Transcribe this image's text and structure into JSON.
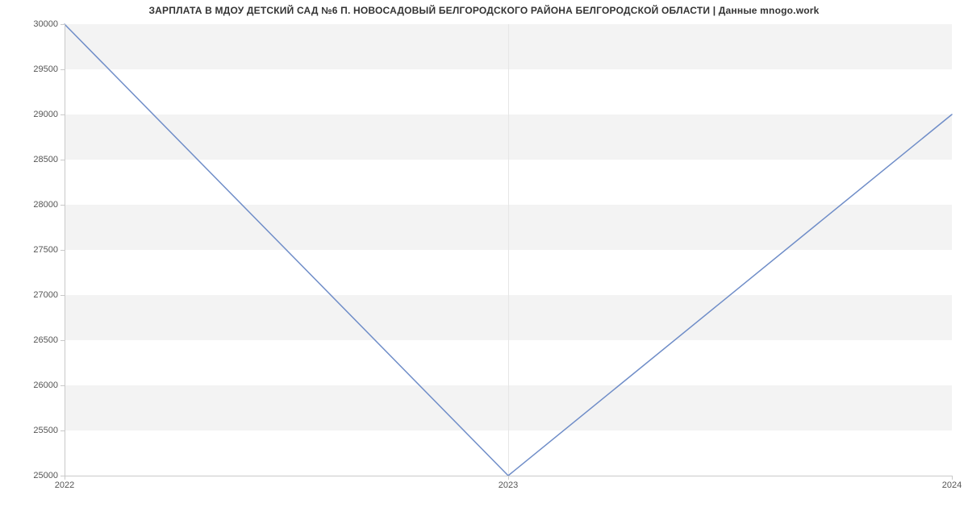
{
  "chart_data": {
    "type": "line",
    "title": "ЗАРПЛАТА В МДОУ ДЕТСКИЙ САД №6 П. НОВОСАДОВЫЙ БЕЛГОРОДСКОГО РАЙОНА БЕЛГОРОДСКОЙ ОБЛАСТИ | Данные mnogo.work",
    "xlabel": "",
    "ylabel": "",
    "x": [
      "2022",
      "2023",
      "2024"
    ],
    "values": [
      30000,
      25000,
      29000
    ],
    "ylim": [
      25000,
      30000
    ],
    "y_ticks": [
      25000,
      25500,
      26000,
      26500,
      27000,
      27500,
      28000,
      28500,
      29000,
      29500,
      30000
    ],
    "x_ticks": [
      "2022",
      "2023",
      "2024"
    ],
    "series_color": "#6f8dc8",
    "band_color": "#f3f3f3"
  }
}
